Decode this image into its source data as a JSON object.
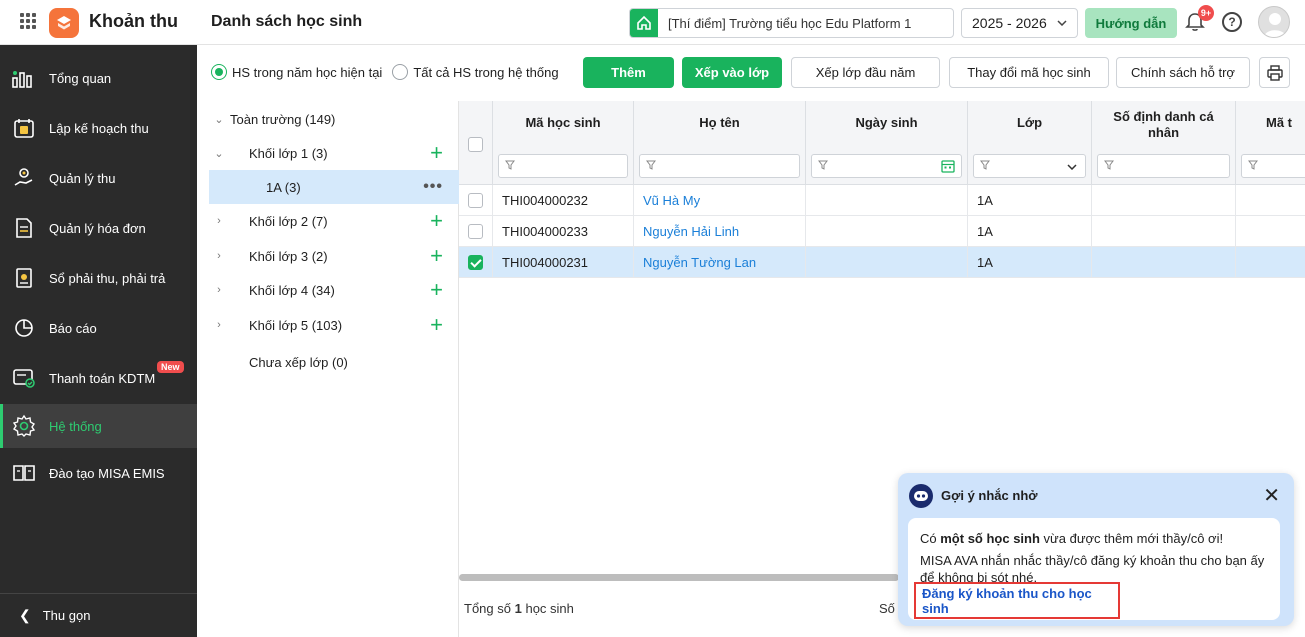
{
  "app": {
    "name": "Khoản thu",
    "page_title": "Danh sách học sinh"
  },
  "header": {
    "school": "[Thí điểm] Trường tiểu học Edu Platform 1",
    "year": "2025 - 2026",
    "guide_label": "Hướng dẫn",
    "notification_count": "9+"
  },
  "sidebar": {
    "items": [
      {
        "label": "Tổng quan",
        "icon": "dashboard-icon"
      },
      {
        "label": "Lập kế hoạch thu",
        "icon": "calendar-money-icon"
      },
      {
        "label": "Quản lý thu",
        "icon": "hand-money-icon"
      },
      {
        "label": "Quản lý hóa đơn",
        "icon": "invoice-icon"
      },
      {
        "label": "Sổ phải thu, phải trả",
        "icon": "ledger-icon"
      },
      {
        "label": "Báo cáo",
        "icon": "pie-chart-icon"
      },
      {
        "label": "Thanh toán KDTM",
        "icon": "payment-icon",
        "badge": "New"
      },
      {
        "label": "Hệ thống",
        "icon": "gear-icon",
        "active": true
      },
      {
        "label": "Đào tạo MISA EMIS",
        "icon": "book-icon"
      }
    ],
    "collapse_label": "Thu gọn"
  },
  "filters": {
    "radio_current": "HS trong năm học hiện tại",
    "radio_all": "Tất cả HS trong hệ thống"
  },
  "toolbar": {
    "add": "Thêm",
    "assign_class": "Xếp vào lớp",
    "assign_start": "Xếp lớp đầu năm",
    "change_code": "Thay đổi mã học sinh",
    "support_policy": "Chính sách hỗ trợ"
  },
  "tree": {
    "root": "Toàn trường (149)",
    "grades": [
      {
        "label": "Khối lớp 1 (3)",
        "expanded": true
      },
      {
        "label": "1A (3)",
        "child": true
      },
      {
        "label": "Khối lớp 2 (7)"
      },
      {
        "label": "Khối lớp 3 (2)"
      },
      {
        "label": "Khối lớp 4 (34)"
      },
      {
        "label": "Khối lớp 5 (103)"
      }
    ],
    "unassigned": "Chưa xếp lớp (0)"
  },
  "table": {
    "columns": [
      "Mã học sinh",
      "Họ tên",
      "Ngày sinh",
      "Lớp",
      "Số định danh cá nhân",
      "Mã t"
    ],
    "rows": [
      {
        "code": "THI004000232",
        "name": "Vũ Hà My",
        "dob": "",
        "class": "1A",
        "id": "",
        "checked": false
      },
      {
        "code": "THI004000233",
        "name": "Nguyễn Hải Linh",
        "dob": "",
        "class": "1A",
        "id": "",
        "checked": false
      },
      {
        "code": "THI004000231",
        "name": "Nguyễn Tường Lan",
        "dob": "",
        "class": "1A",
        "id": "",
        "checked": true
      }
    ],
    "total_prefix": "Tổng số",
    "total_count": "1",
    "total_suffix": "học sinh",
    "pager_partial": "Số d"
  },
  "popup": {
    "title": "Gợi ý nhắc nhở",
    "line1_pre": "Có",
    "line1_bold": "một số học sinh",
    "line1_post": "vừa được thêm mới thầy/cô ơi!",
    "line2": "MISA AVA nhắn nhắc thầy/cô đăng ký khoản thu cho bạn ấy để không bị sót nhé.",
    "link": "Đăng ký khoản thu cho học sinh"
  },
  "colors": {
    "accent": "#19b35d",
    "sidebar": "#2b2b2b",
    "link": "#1a7fd8",
    "selected_row": "#d5e9fb",
    "highlight_border": "#e53935"
  }
}
